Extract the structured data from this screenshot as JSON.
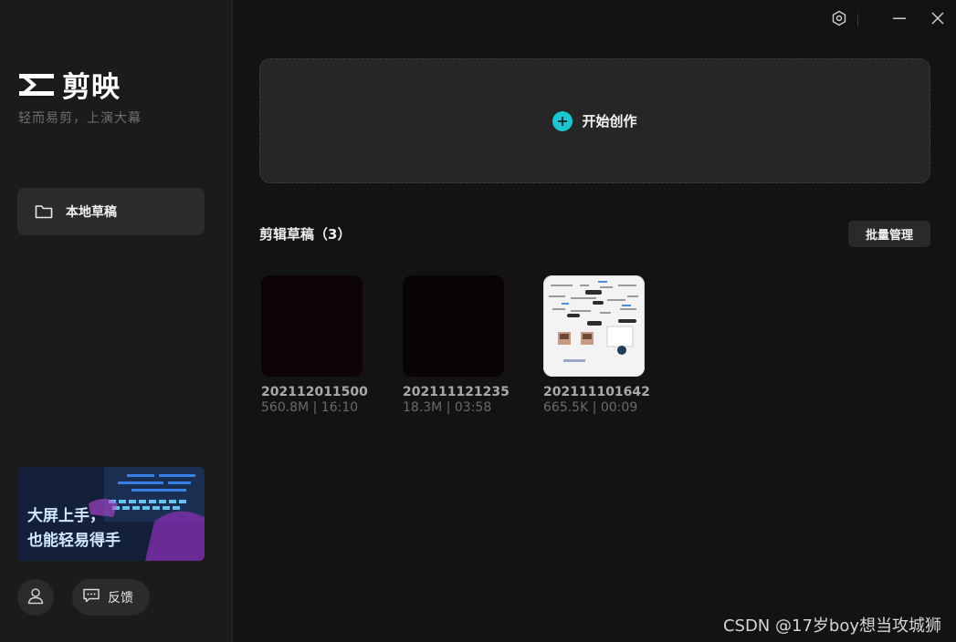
{
  "app": {
    "logo_text": "剪映",
    "slogan": "轻而易剪，上演大幕"
  },
  "sidebar": {
    "local_drafts_label": "本地草稿",
    "promo": {
      "line1": "大屏上手，",
      "line2": "也能轻易得手"
    },
    "feedback_label": "反馈"
  },
  "main": {
    "create_label": "开始创作",
    "section_title": "剪辑草稿（3）",
    "batch_manage_label": "批量管理",
    "drafts": [
      {
        "name": "202112011500",
        "size": "560.8M",
        "duration": "16:10",
        "separator": " | "
      },
      {
        "name": "202111121235",
        "size": "18.3M",
        "duration": "03:58",
        "separator": " | "
      },
      {
        "name": "202111101642",
        "size": "665.5K",
        "duration": "00:09",
        "separator": " | "
      }
    ]
  },
  "watermark": "CSDN @17岁boy想当攻城狮",
  "colors": {
    "accent": "#19c6d2",
    "sidebar_bg": "#1b1b1b",
    "main_bg": "#131313",
    "card_bg": "#262626"
  },
  "icons": {
    "settings": "settings-icon",
    "minimize": "minimize-icon",
    "close": "close-icon",
    "folder": "folder-icon",
    "user": "user-icon",
    "feedback": "chat-icon",
    "plus": "plus-icon"
  }
}
